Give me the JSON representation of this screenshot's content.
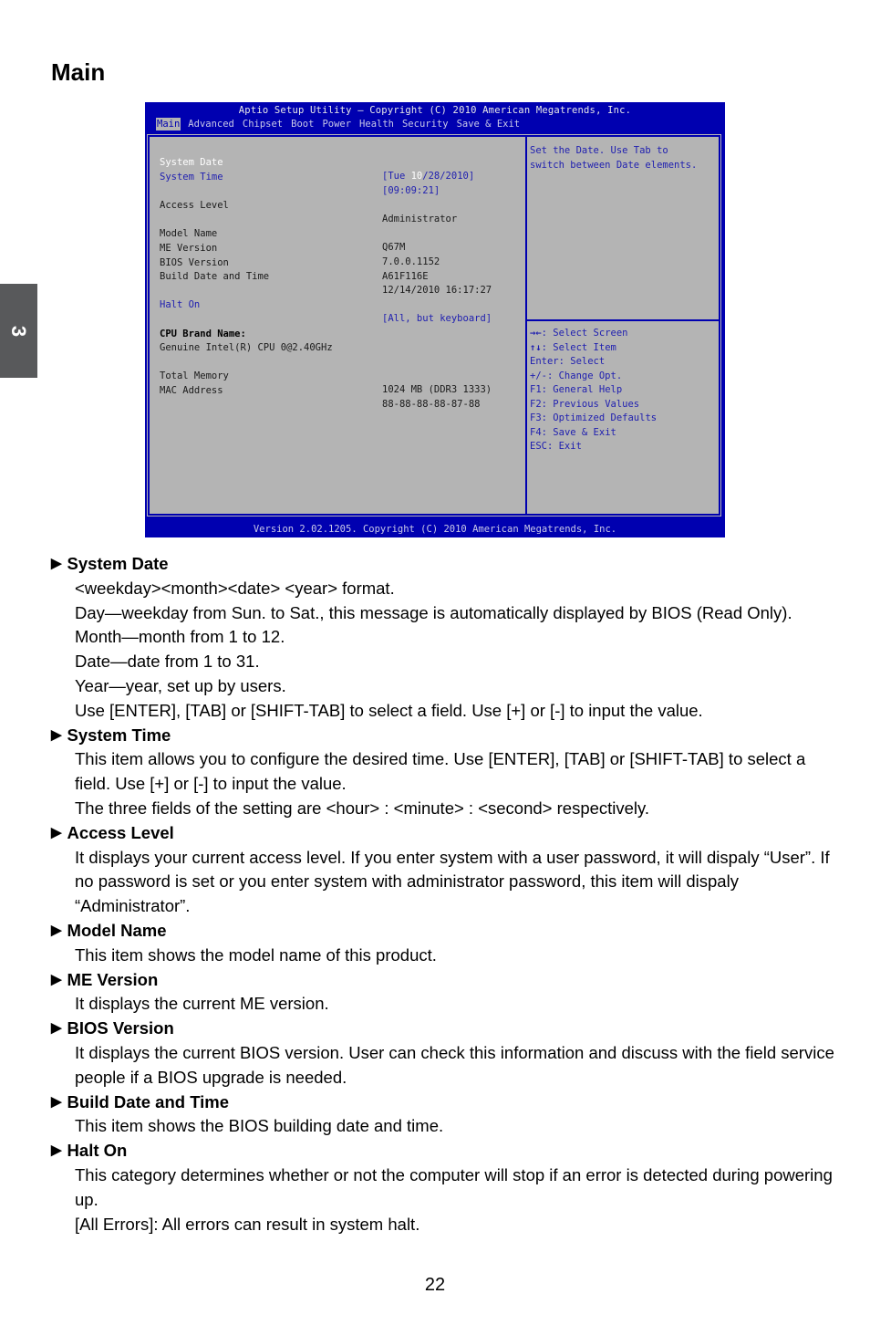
{
  "side_tab": {
    "chapter": "3"
  },
  "page_title": "Main",
  "bios": {
    "title": "Aptio Setup Utility – Copyright (C) 2010 American Megatrends, Inc.",
    "menu": [
      "Main",
      "Advanced",
      "Chipset",
      "Boot",
      "Power",
      "Health",
      "Security",
      "Save & Exit"
    ],
    "active_menu": "Main",
    "rows": {
      "system_date": {
        "label": "System Date",
        "val_pre": "[Tue ",
        "val_hl": "10",
        "val_post": "/28/2010]"
      },
      "system_time": {
        "label": "System Time",
        "value": "[09:09:21]"
      },
      "access_level": {
        "label": "Access Level",
        "value": "Administrator"
      },
      "model_name": {
        "label": "Model Name",
        "value": "Q67M"
      },
      "me_version": {
        "label": "ME Version",
        "value": "7.0.0.1152"
      },
      "bios_version": {
        "label": "BIOS Version",
        "value": "A61F116E"
      },
      "build_date": {
        "label": "Build Date and Time",
        "value": "12/14/2010 16:17:27"
      },
      "halt_on": {
        "label": "Halt On",
        "value": "[All, but keyboard]"
      },
      "cpu_brand_label": "CPU Brand Name:",
      "cpu_brand_value": "Genuine Intel(R) CPU 0@2.40GHz",
      "total_memory": {
        "label": "Total Memory",
        "value": "1024 MB (DDR3 1333)"
      },
      "mac_address": {
        "label": "MAC Address",
        "value": "88-88-88-88-87-88"
      }
    },
    "help_text": "Set the Date. Use Tab to\nswitch between Date elements.",
    "keys": [
      {
        "key": "→←",
        "desc": ": Select Screen"
      },
      {
        "key": "↑↓",
        "desc": ": Select Item"
      },
      {
        "key": "Enter",
        "desc": ": Select"
      },
      {
        "key": "+/-",
        "desc": ": Change Opt."
      },
      {
        "key": "F1",
        "desc": ": General Help"
      },
      {
        "key": "F2",
        "desc": ": Previous Values"
      },
      {
        "key": "F3",
        "desc": ": Optimized Defaults"
      },
      {
        "key": "F4",
        "desc": ": Save & Exit"
      },
      {
        "key": "ESC",
        "desc": ": Exit"
      }
    ],
    "footer": "Version 2.02.1205. Copyright (C) 2010 American Megatrends, Inc."
  },
  "sections": [
    {
      "title": "System Date",
      "lines": [
        "<weekday><month><date> <year> format.",
        "Day—weekday from Sun. to Sat., this message is automatically displayed by BIOS (Read Only).",
        "Month—month from 1 to 12.",
        "Date—date from 1 to 31.",
        "Year—year, set up by users.",
        "Use [ENTER], [TAB] or [SHIFT-TAB] to select a field. Use [+] or [-] to input the value."
      ]
    },
    {
      "title": "System Time",
      "lines": [
        "This item allows you to configure the desired time. Use [ENTER], [TAB] or [SHIFT-TAB] to select a field. Use [+] or [-] to input the value.",
        "The three fields of the setting are <hour> : <minute> : <second> respectively."
      ]
    },
    {
      "title": "Access Level",
      "lines": [
        "It displays your current access level. If you enter system with a user password, it will dispaly “User”. If no password is set or you enter system with administrator password, this item will dispaly “Administrator”."
      ]
    },
    {
      "title": "Model Name",
      "lines": [
        "This item shows the model name of this product."
      ]
    },
    {
      "title": "ME Version",
      "lines": [
        "It displays the current ME version."
      ]
    },
    {
      "title": "BIOS Version",
      "lines": [
        "It displays the current BIOS version. User can check this information and discuss with the field service people if a BIOS upgrade is needed."
      ]
    },
    {
      "title": "Build Date and Time",
      "lines": [
        "This item shows the BIOS building date and time."
      ]
    },
    {
      "title": "Halt On",
      "lines": [
        "This category determines whether or not the computer will stop if an error is detected during powering up.",
        "[All Errors]: All errors can result in system halt."
      ]
    }
  ],
  "page_number": "22",
  "colors": {
    "bios_blue": "#0000b0",
    "bios_gray": "#b4b4b4",
    "bios_item_blue": "#2020b0",
    "side_tab": "#58595b"
  }
}
